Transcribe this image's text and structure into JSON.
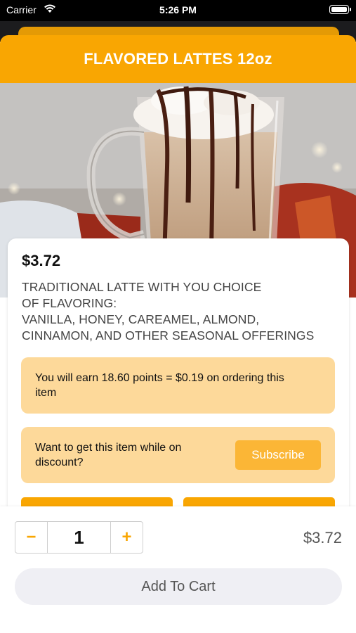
{
  "status_bar": {
    "carrier": "Carrier",
    "time": "5:26 PM"
  },
  "header": {
    "title": "FLAVORED LATTES 12oz",
    "background": "#f9a602"
  },
  "hero": {
    "icon": "latte-glass-photo"
  },
  "product": {
    "price": "$3.72",
    "description_lines": [
      "TRADITIONAL LATTE WITH YOU CHOICE",
      "OF FLAVORING:",
      "VANILLA, HONEY, CAREAMEL, ALMOND,",
      "CINNAMON, AND OTHER SEASONAL OFFERINGS"
    ],
    "points_text": "You will earn 18.60 points = $0.19 on ordering this item",
    "subscribe_text": "Want to get this item while on discount?",
    "subscribe_button": "Subscribe"
  },
  "bottom": {
    "minus_label": "−",
    "quantity": "1",
    "plus_label": "+",
    "total_price": "$3.72",
    "add_to_cart": "Add To Cart"
  },
  "colors": {
    "accent": "#f9a602",
    "info_box": "#fdd99a",
    "subscribe_button": "#fbb636"
  }
}
